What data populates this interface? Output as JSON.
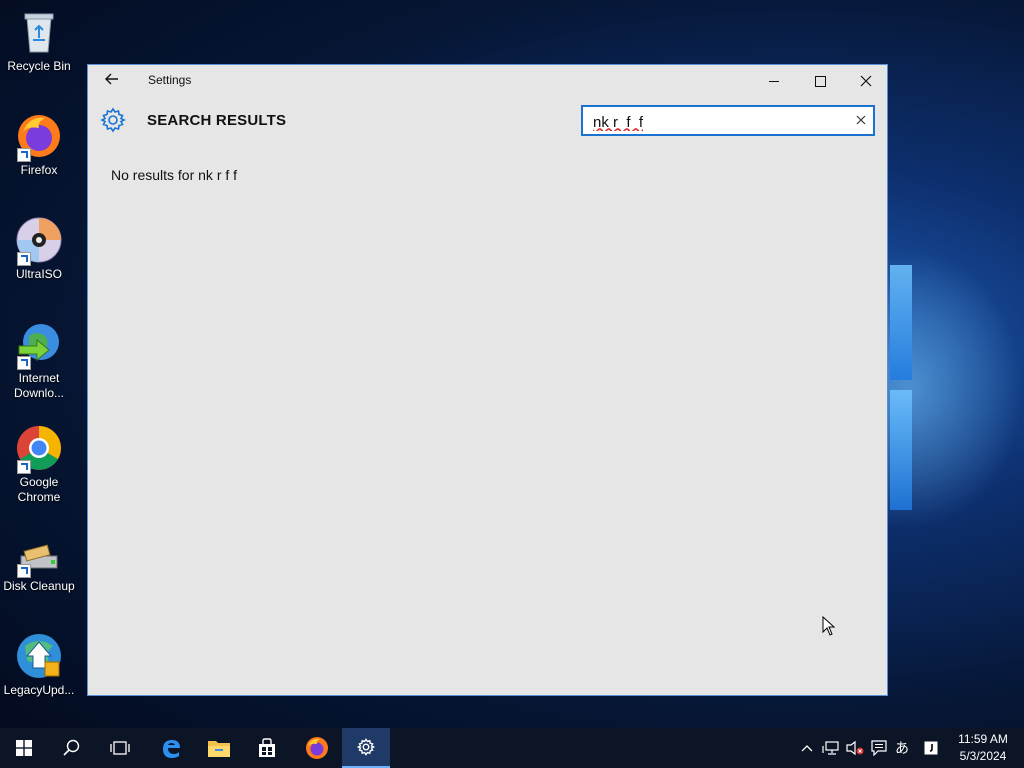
{
  "desktop": {
    "icons": [
      {
        "label": "Recycle Bin"
      },
      {
        "label": "Firefox"
      },
      {
        "label": "UltraISO"
      },
      {
        "label": "Internet Downlo..."
      },
      {
        "label": "Google Chrome"
      },
      {
        "label": "Disk Cleanup"
      },
      {
        "label": "LegacyUpd..."
      }
    ]
  },
  "window": {
    "title": "Settings",
    "heading": "SEARCH RESULTS",
    "search": {
      "value": "nk r  f  f"
    },
    "no_results": "No results for nk r  f  f"
  },
  "taskbar": {
    "time": "11:59 AM",
    "date": "5/3/2024",
    "ime": "あ"
  },
  "colors": {
    "accent": "#1a73d0",
    "window_bg": "#e6e6e6",
    "taskbar_bg": "#0c1526"
  }
}
